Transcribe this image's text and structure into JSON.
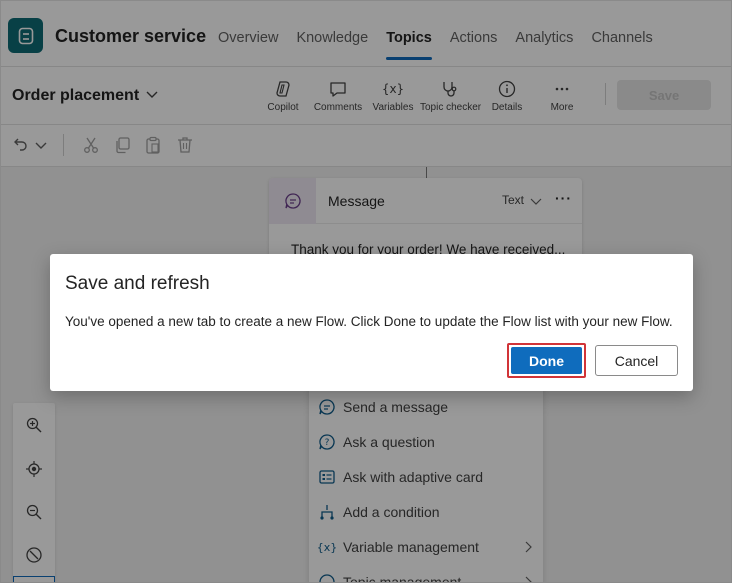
{
  "header": {
    "app_title": "Customer service",
    "nav": [
      "Overview",
      "Knowledge",
      "Topics",
      "Actions",
      "Analytics",
      "Channels"
    ],
    "active_nav": "Topics"
  },
  "toolbar": {
    "topic_name": "Order placement",
    "tools": [
      {
        "label": "Copilot",
        "icon": "copilot-icon"
      },
      {
        "label": "Comments",
        "icon": "comment-icon"
      },
      {
        "label": "Variables",
        "icon": "variables-icon"
      },
      {
        "label": "Topic checker",
        "icon": "stethoscope-icon"
      },
      {
        "label": "Details",
        "icon": "info-icon"
      },
      {
        "label": "More",
        "icon": "more-icon"
      }
    ],
    "save_label": "Save"
  },
  "canvas": {
    "message_card": {
      "title": "Message",
      "type": "Text",
      "text": "Thank you for your order! We have received..."
    },
    "add_menu": [
      {
        "label": "Send a message",
        "icon": "message-icon",
        "submenu": false
      },
      {
        "label": "Ask a question",
        "icon": "question-icon",
        "submenu": false
      },
      {
        "label": "Ask with adaptive card",
        "icon": "card-icon",
        "submenu": false
      },
      {
        "label": "Add a condition",
        "icon": "branch-icon",
        "submenu": false
      },
      {
        "label": "Variable management",
        "icon": "variables-icon",
        "submenu": true
      },
      {
        "label": "Topic management",
        "icon": "topic-icon",
        "submenu": true
      }
    ]
  },
  "dialog": {
    "title": "Save and refresh",
    "body": "You've opened a new tab to create a new Flow. Click Done to update the Flow list with your new Flow.",
    "done_label": "Done",
    "cancel_label": "Cancel"
  },
  "colors": {
    "accent": "#0f6cbd",
    "app_icon": "#0e6b75",
    "highlight": "#d13438"
  }
}
